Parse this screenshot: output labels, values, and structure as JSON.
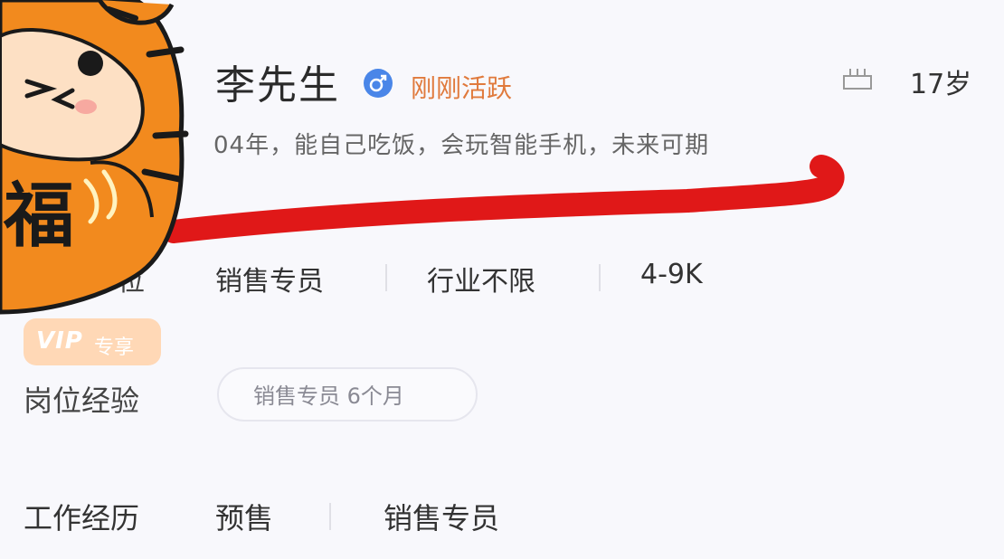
{
  "profile": {
    "name": "李先生",
    "gender_icon": "male-icon",
    "active_status": "刚刚活跃",
    "age": "17岁",
    "bio": "04年，能自己吃饭，会玩智能手机，未来可期"
  },
  "expectation": {
    "label_partial": "位",
    "position": "销售专员",
    "industry": "行业不限",
    "salary": "4-9K"
  },
  "vip_badge": {
    "text": "VIP",
    "sub": "专享"
  },
  "experience": {
    "label": "岗位经验",
    "tag": "销售专员 6个月"
  },
  "work_history": {
    "label": "工作经历",
    "company": "预售",
    "title": "销售专员"
  },
  "mascot": {
    "text": "福"
  },
  "colors": {
    "accent_orange": "#e07a3c",
    "gender_blue": "#4a86e8",
    "annotation_red": "#e01818",
    "mascot_orange": "#f28a1e"
  }
}
